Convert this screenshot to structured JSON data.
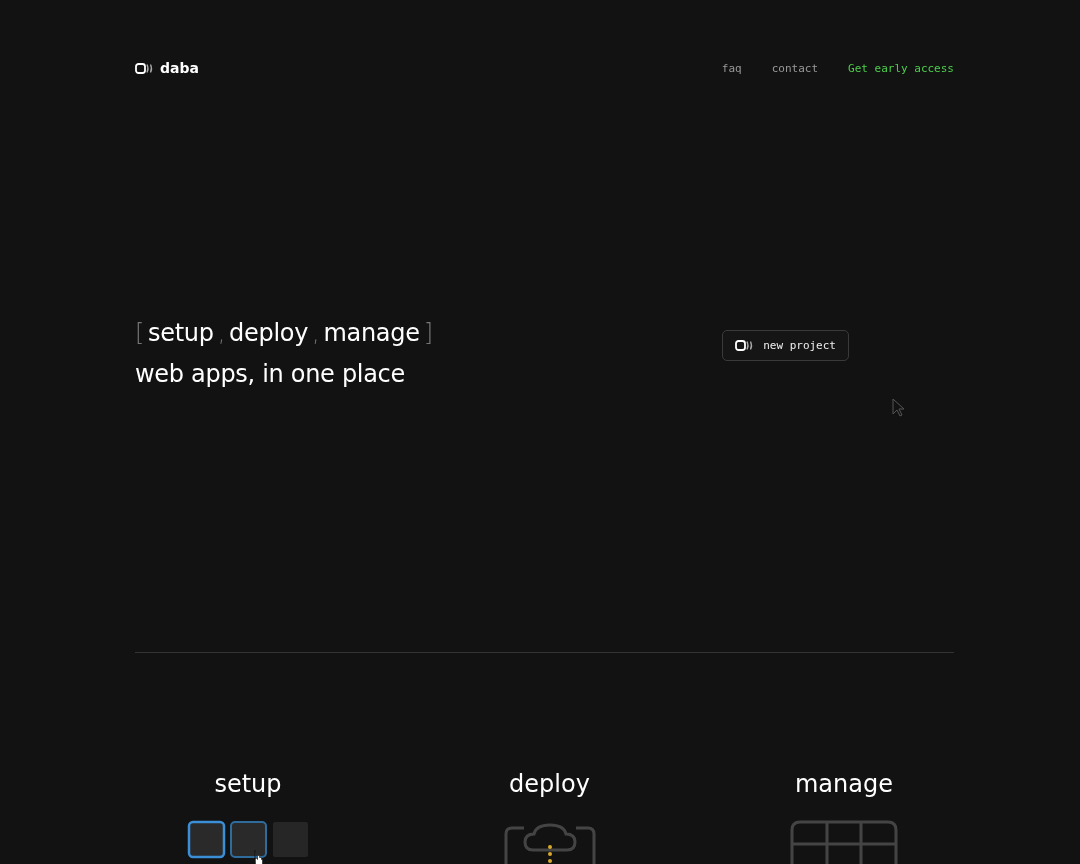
{
  "header": {
    "brand": "daba",
    "nav": [
      {
        "label": "faq",
        "kind": "link"
      },
      {
        "label": "contact",
        "kind": "link"
      },
      {
        "label": "Get early access",
        "kind": "cta"
      }
    ]
  },
  "hero": {
    "open": "[",
    "words": [
      "setup",
      "deploy",
      "manage"
    ],
    "separators": [
      ",",
      ","
    ],
    "close": "]",
    "tagline": "web apps, in one place",
    "button": "new project"
  },
  "features": [
    {
      "title": "setup",
      "kind": "setup"
    },
    {
      "title": "deploy",
      "kind": "deploy"
    },
    {
      "title": "manage",
      "kind": "manage"
    }
  ]
}
